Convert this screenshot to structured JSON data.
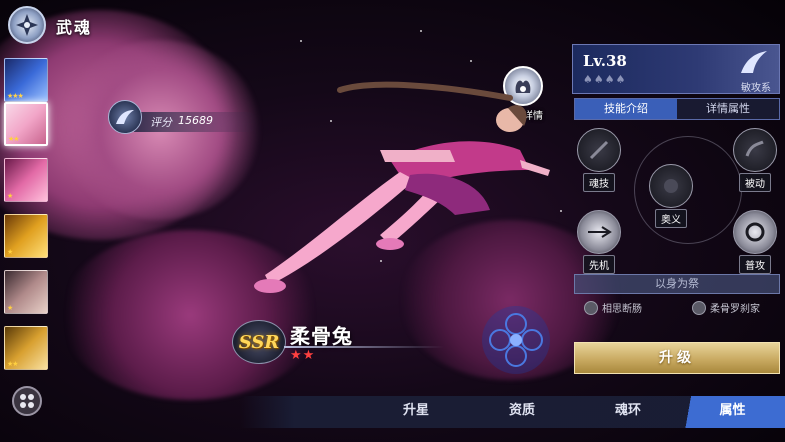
{
  "header": {
    "title": "武魂"
  },
  "rating": {
    "label": "评分",
    "value": "15689"
  },
  "spirit_detail": {
    "label": "武魂详情"
  },
  "spirit": {
    "rarity": "SSR",
    "name": "柔骨兔",
    "stars": "★★"
  },
  "roster": [
    {
      "stars": "★★★",
      "color": "#3a6ad8"
    },
    {
      "stars": "★★",
      "color": "#f2a6c8",
      "selected": true
    },
    {
      "stars": "★",
      "color": "#e26aa6"
    },
    {
      "stars": "★",
      "color": "#e0a020"
    },
    {
      "stars": "★",
      "color": "#b08a8a"
    },
    {
      "stars": "★★",
      "color": "#d8a030"
    }
  ],
  "panel": {
    "level": "Lv.38",
    "level_pips": "♠♠♠♠",
    "type_label": "敏攻系",
    "tabs": [
      {
        "label": "技能介绍",
        "active": true
      },
      {
        "label": "详情属性",
        "active": false
      }
    ],
    "skills": {
      "soul_skill": "魂技",
      "passive": "被动",
      "ultimate": "奥义",
      "initiative": "先机",
      "normal_attack": "普攻"
    },
    "sacrifice": "以身为祭",
    "bonds": [
      "相思断肠",
      "柔骨罗刹家"
    ],
    "upgrade": "升级"
  },
  "bottom_nav": [
    {
      "label": "升星",
      "active": false
    },
    {
      "label": "资质",
      "active": false
    },
    {
      "label": "魂环",
      "active": false
    },
    {
      "label": "属性",
      "active": true
    }
  ]
}
